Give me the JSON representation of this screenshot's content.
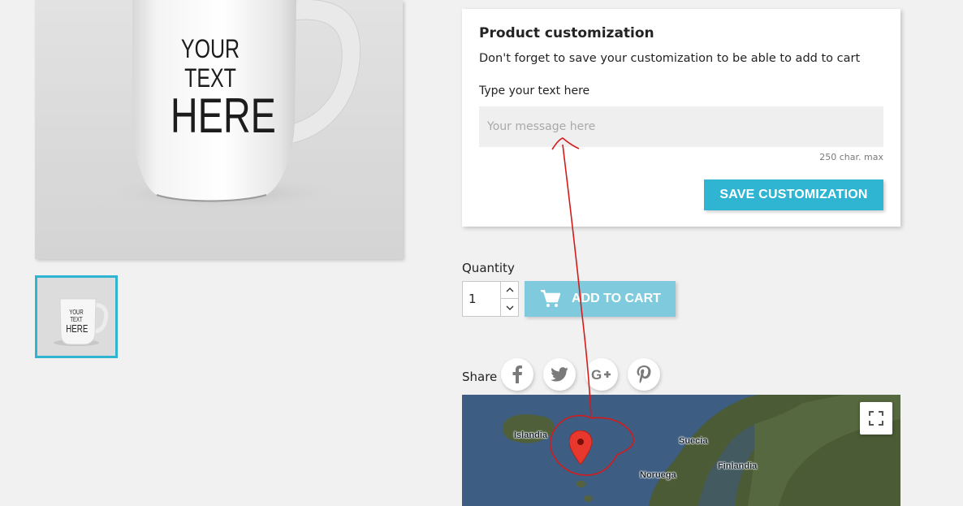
{
  "product": {
    "mug_text_line1": "YOUR TEXT",
    "mug_text_line2": "HERE"
  },
  "customization": {
    "title": "Product customization",
    "description": "Don't forget to save your customization to be able to add to cart",
    "field_label": "Type your text here",
    "placeholder": "Your message here",
    "char_limit": "250 char. max",
    "save_label": "SAVE CUSTOMIZATION"
  },
  "purchase": {
    "quantity_label": "Quantity",
    "quantity_value": "1",
    "add_to_cart_label": "ADD TO CART"
  },
  "share": {
    "label": "Share",
    "networks": [
      "facebook-icon",
      "twitter-icon",
      "google-plus-icon",
      "pinterest-icon"
    ]
  },
  "map": {
    "labels": [
      "Islandia",
      "Suecia",
      "Finlandia",
      "Noruega"
    ]
  },
  "colors": {
    "accent": "#2fb5d2",
    "accent_disabled": "#7fcbdd",
    "annotation": "#d41b1b"
  }
}
